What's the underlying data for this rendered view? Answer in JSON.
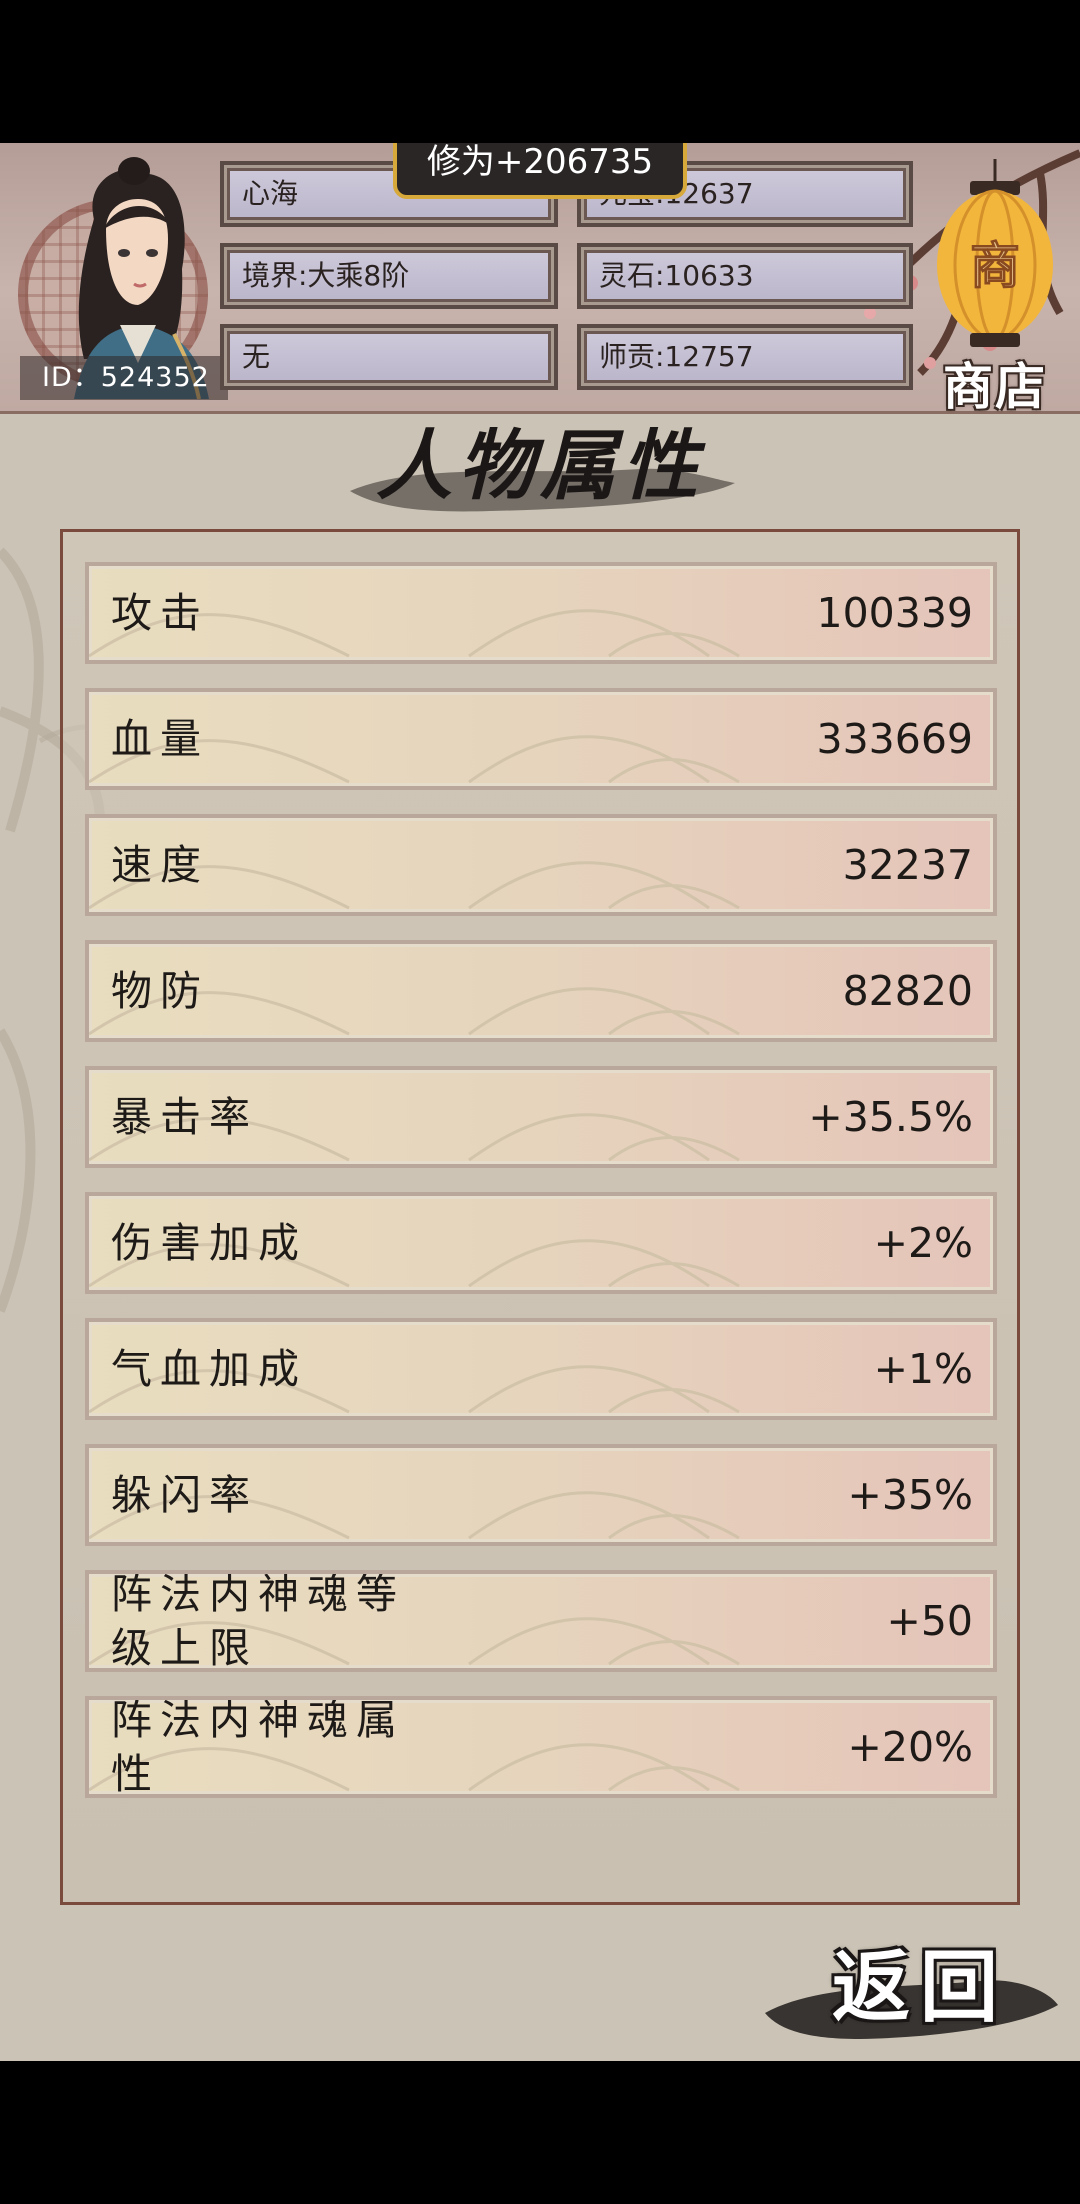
{
  "header": {
    "player_id": "ID：524352",
    "cultivation_popup": "修为+206735",
    "name": "心海",
    "yuanbao": "元宝:12637",
    "realm": "境界:大乘8阶",
    "lingshi": "灵石:10633",
    "sect": "无",
    "shigong": "师贡:12757",
    "shop_label": "商店",
    "shop_lantern_char": "商"
  },
  "page_title": "人物属性",
  "attributes": [
    {
      "label": "攻击",
      "value": "100339"
    },
    {
      "label": "血量",
      "value": "333669"
    },
    {
      "label": "速度",
      "value": "32237"
    },
    {
      "label": "物防",
      "value": "82820"
    },
    {
      "label": "暴击率",
      "value": "+35.5%"
    },
    {
      "label": "伤害加成",
      "value": "+2%"
    },
    {
      "label": "气血加成",
      "value": "+1%"
    },
    {
      "label": "躲闪率",
      "value": "+35%"
    },
    {
      "label": "阵法内神魂等级上限",
      "value": "+50"
    },
    {
      "label": "阵法内神魂属性",
      "value": "+20%"
    }
  ],
  "back_label": "返回",
  "colors": {
    "panel_border": "#7a4b3c",
    "popup_border": "#d7a83a",
    "row_gradient_start": "#e8ddbf",
    "row_gradient_end": "#e5c4b9"
  }
}
